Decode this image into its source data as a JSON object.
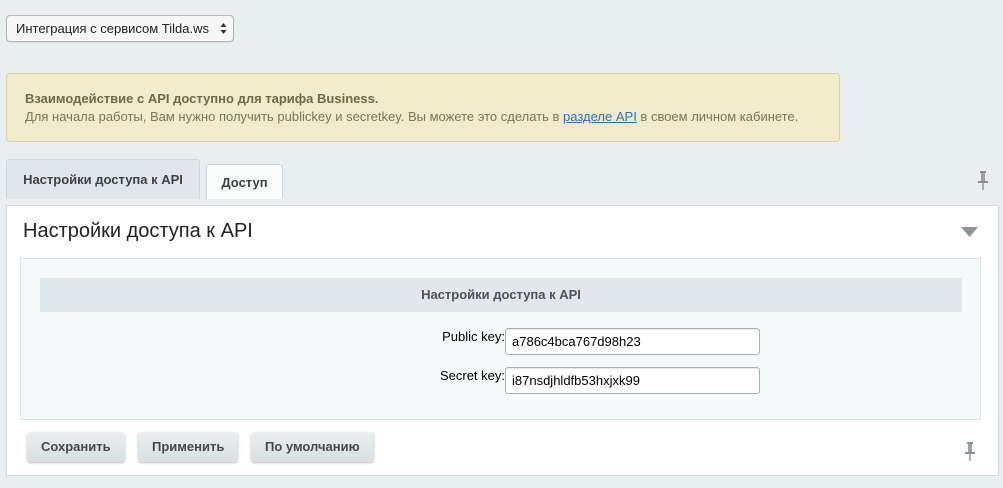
{
  "module_select": {
    "value": "Интеграция с сервисом Tilda.ws"
  },
  "notice": {
    "title": "Взаимодействие с API доступно для тарифа Business.",
    "text_before": "Для начала работы, Вам нужно получить publickey и secretkey. Вы можете это сделать в ",
    "link": "разделе API",
    "text_after": " в своем личном кабинете."
  },
  "tabs": [
    {
      "label": "Настройки доступа к API",
      "active": true
    },
    {
      "label": "Доступ",
      "active": false
    }
  ],
  "panel": {
    "title": "Настройки доступа к API",
    "section_header": "Настройки доступа к API",
    "fields": [
      {
        "label": "Public key:",
        "value": "a786c4bca767d98h23"
      },
      {
        "label": "Secret key:",
        "value": "i87nsdjhldfb53hxjxk99"
      }
    ]
  },
  "buttons": {
    "save": "Сохранить",
    "apply": "Применить",
    "default": "По умолчанию"
  },
  "colors": {
    "notice_bg": "#efebcb",
    "link": "#2e6fbd",
    "page_bg": "#e9eef0"
  }
}
